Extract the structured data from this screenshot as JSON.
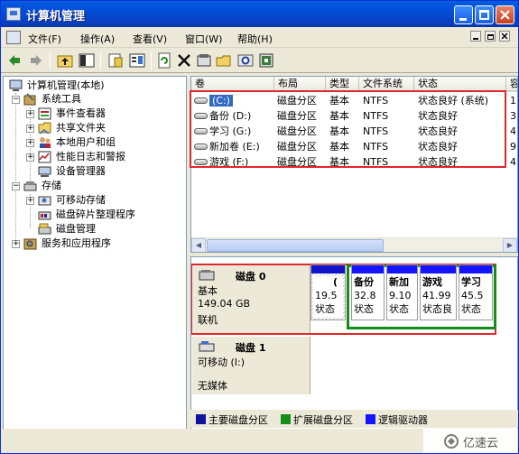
{
  "window": {
    "title": "计算机管理"
  },
  "menu": {
    "items": [
      "文件(F)",
      "操作(A)",
      "查看(V)",
      "窗口(W)",
      "帮助(H)"
    ]
  },
  "toolbar": {
    "icons": [
      "back-arrow-icon",
      "forward-arrow-icon",
      "up-folder-icon",
      "show-hide-tree-icon",
      "properties-icon",
      "export-list-icon",
      "refresh-icon",
      "delete-icon",
      "disk-properties-icon",
      "open-icon",
      "search-icon",
      "help-icon"
    ]
  },
  "tree": {
    "root": "计算机管理(本地)",
    "system_tools": "系统工具",
    "event_viewer": "事件查看器",
    "shared_folders": "共享文件夹",
    "local_users": "本地用户和组",
    "perf_logs": "性能日志和警报",
    "device_manager": "设备管理器",
    "storage": "存储",
    "removable": "可移动存储",
    "defrag": "磁盘碎片整理程序",
    "disk_mgmt": "磁盘管理",
    "services": "服务和应用程序"
  },
  "volume_list": {
    "columns": [
      "卷",
      "布局",
      "类型",
      "文件系统",
      "状态",
      "容"
    ],
    "rows": [
      {
        "volume": "(C:)",
        "layout": "磁盘分区",
        "type": "基本",
        "fs": "NTFS",
        "status": "状态良好 (系统)",
        "cap": "1",
        "selected": true
      },
      {
        "volume": "备份 (D:)",
        "layout": "磁盘分区",
        "type": "基本",
        "fs": "NTFS",
        "status": "状态良好",
        "cap": "3",
        "selected": false
      },
      {
        "volume": "学习 (G:)",
        "layout": "磁盘分区",
        "type": "基本",
        "fs": "NTFS",
        "status": "状态良好",
        "cap": "4",
        "selected": false
      },
      {
        "volume": "新加卷 (E:)",
        "layout": "磁盘分区",
        "type": "基本",
        "fs": "NTFS",
        "status": "状态良好",
        "cap": "9",
        "selected": false
      },
      {
        "volume": "游戏 (F:)",
        "layout": "磁盘分区",
        "type": "基本",
        "fs": "NTFS",
        "status": "状态良好",
        "cap": "4",
        "selected": false
      }
    ]
  },
  "disk0": {
    "name": "磁盘 0",
    "type": "基本",
    "size": "149.04 GB",
    "state": "联机",
    "partitions": [
      {
        "title": "(",
        "size": "19.5",
        "status": "状态"
      },
      {
        "title": "备份",
        "size": "32.8",
        "status": "状态"
      },
      {
        "title": "新加",
        "size": "9.10",
        "status": "状态"
      },
      {
        "title": "游戏",
        "size": "41.99",
        "status": "状态良"
      },
      {
        "title": "学习",
        "size": "45.5",
        "status": "状态"
      }
    ]
  },
  "disk1": {
    "name": "磁盘 1",
    "type": "可移动 (I:)",
    "media": "无媒体"
  },
  "legend": {
    "primary": "主要磁盘分区",
    "extended": "扩展磁盘分区",
    "logical": "逻辑驱动器",
    "primary_color": "#1212a0",
    "extended_color": "#168d16",
    "logical_color": "#1414ff"
  },
  "watermark": {
    "text": "亿速云"
  },
  "colors": {
    "highlight": "#e0282c",
    "extended_box": "#168d16",
    "selection": "#316ac5"
  }
}
